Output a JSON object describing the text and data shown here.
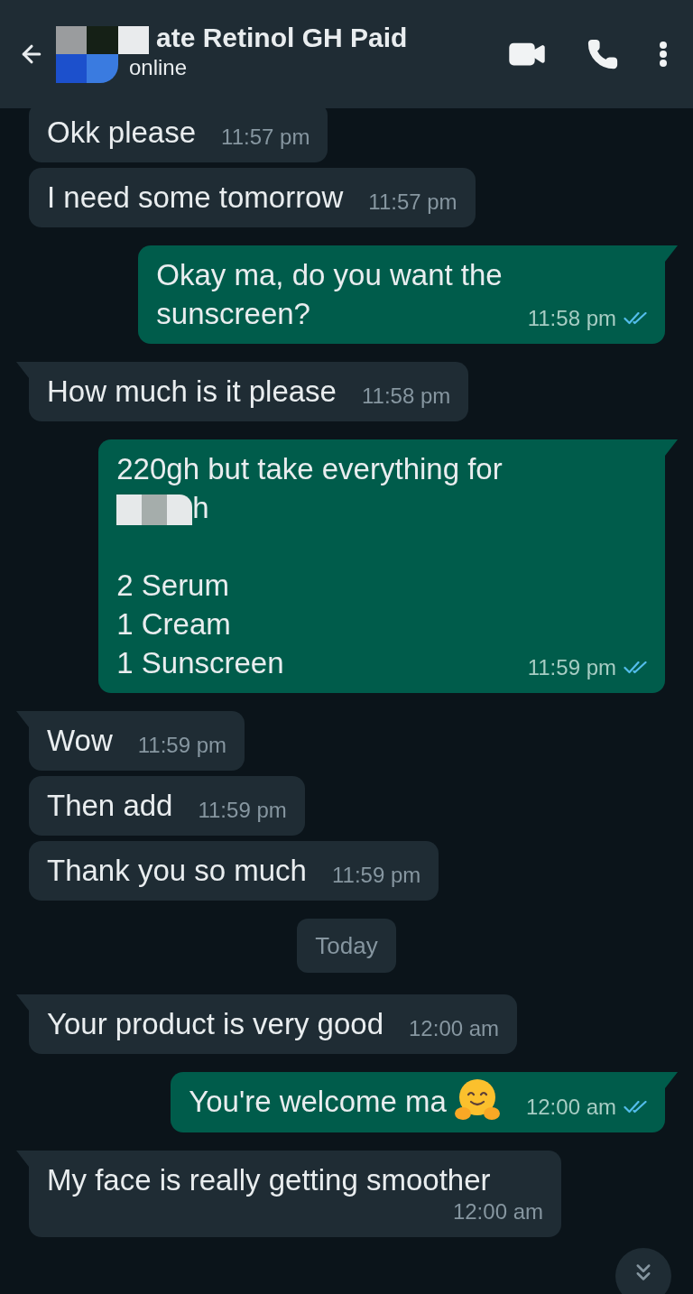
{
  "header": {
    "title": "ate Retinol GH Paid",
    "status": "online"
  },
  "messages": [
    {
      "kind": "message",
      "outgoing": false,
      "tail": false,
      "emoji": false,
      "lines": [
        {
          "kind": "text",
          "text": "Okk please"
        }
      ],
      "time": "11:57 pm"
    },
    {
      "kind": "message",
      "outgoing": false,
      "tail": false,
      "emoji": false,
      "lines": [
        {
          "kind": "text",
          "text": "I need some tomorrow"
        }
      ],
      "time": "11:57 pm"
    },
    {
      "kind": "message",
      "outgoing": true,
      "tail": true,
      "emoji": false,
      "read": true,
      "lines": [
        {
          "kind": "text",
          "text": "Okay ma, do you want the"
        },
        {
          "kind": "text",
          "text": "sunscreen?"
        }
      ],
      "time": "11:58 pm"
    },
    {
      "kind": "message",
      "outgoing": false,
      "tail": true,
      "emoji": false,
      "lines": [
        {
          "kind": "text",
          "text": "How much is it please"
        }
      ],
      "time": "11:58 pm"
    },
    {
      "kind": "message",
      "outgoing": true,
      "tail": true,
      "emoji": false,
      "read": true,
      "lines": [
        {
          "kind": "text",
          "text": "220gh but take everything for"
        },
        {
          "kind": "redacted",
          "text": "h"
        },
        {
          "kind": "text",
          "text": "2 Serum",
          "gap_before": true
        },
        {
          "kind": "text",
          "text": "1 Cream"
        },
        {
          "kind": "text",
          "text": "1 Sunscreen"
        }
      ],
      "time": "11:59 pm"
    },
    {
      "kind": "message",
      "outgoing": false,
      "tail": true,
      "emoji": false,
      "lines": [
        {
          "kind": "text",
          "text": "Wow"
        }
      ],
      "time": "11:59 pm"
    },
    {
      "kind": "message",
      "outgoing": false,
      "tail": false,
      "emoji": false,
      "lines": [
        {
          "kind": "text",
          "text": "Then add"
        }
      ],
      "time": "11:59 pm"
    },
    {
      "kind": "message",
      "outgoing": false,
      "tail": false,
      "emoji": false,
      "lines": [
        {
          "kind": "text",
          "text": "Thank you so much"
        }
      ],
      "time": "11:59 pm"
    },
    {
      "kind": "date",
      "text": "Today"
    },
    {
      "kind": "message",
      "outgoing": false,
      "tail": true,
      "emoji": false,
      "lines": [
        {
          "kind": "text",
          "text": "Your product is very good"
        }
      ],
      "time": "12:00 am"
    },
    {
      "kind": "message",
      "outgoing": true,
      "tail": true,
      "emoji": true,
      "read": true,
      "lines": [
        {
          "kind": "text",
          "text": "You're welcome ma"
        }
      ],
      "time": "12:00 am"
    },
    {
      "kind": "message",
      "outgoing": false,
      "tail": true,
      "emoji": false,
      "lines": [
        {
          "kind": "text",
          "text": "My face is really getting smoother"
        }
      ],
      "time": "12:00 am"
    }
  ]
}
